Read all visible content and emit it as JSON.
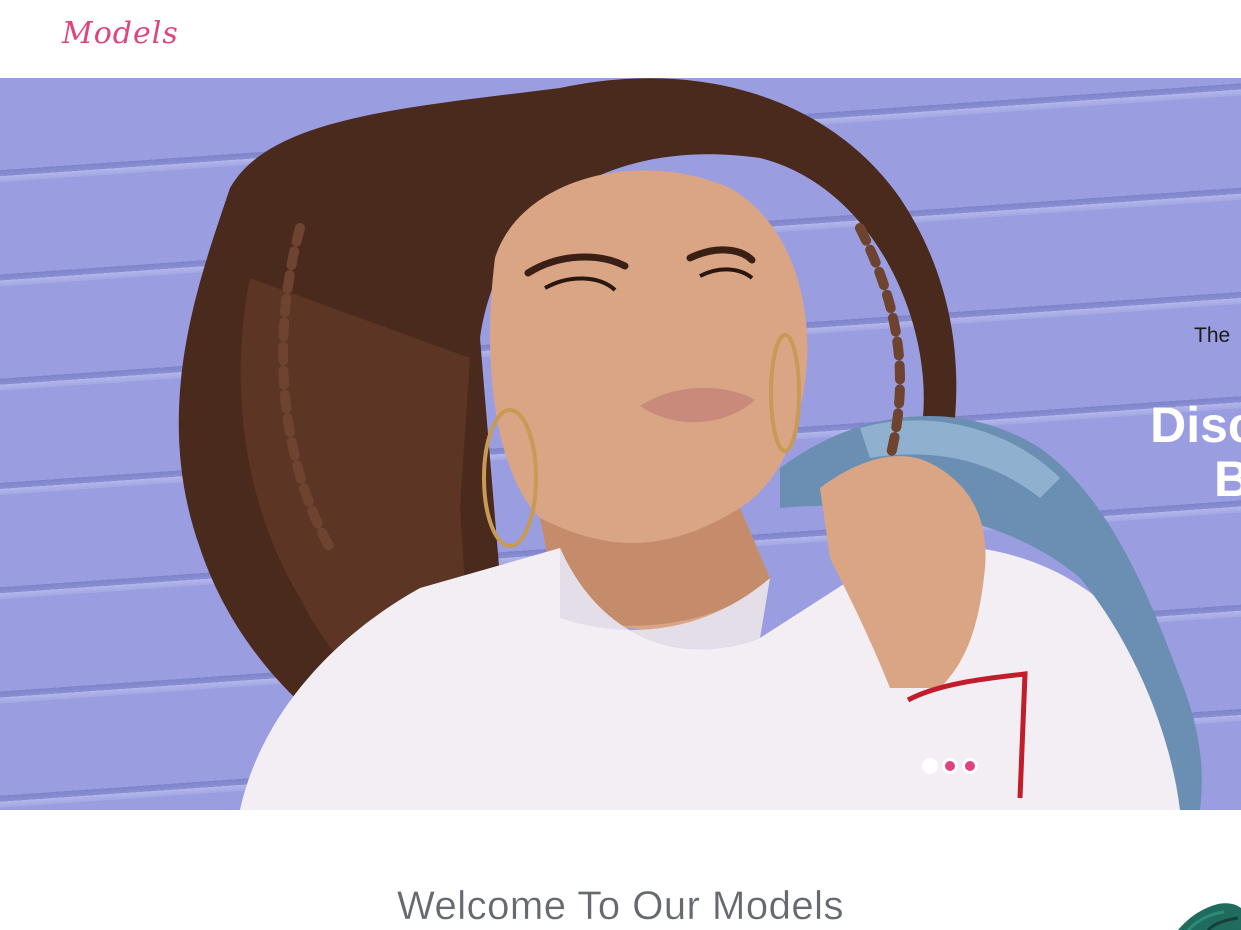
{
  "header": {
    "logo_text": "Models",
    "brand_color": "#e0447f"
  },
  "hero": {
    "kicker": "The",
    "title_line1": "Discove",
    "title_line2": "Be",
    "slides": [
      {
        "state": "active"
      },
      {
        "state": "inactive"
      },
      {
        "state": "inactive"
      }
    ],
    "background_color": "#9a9ee0"
  },
  "welcome": {
    "heading": "Welcome To Our Models"
  },
  "icons": {
    "decor": "plant-decoration-icon"
  }
}
